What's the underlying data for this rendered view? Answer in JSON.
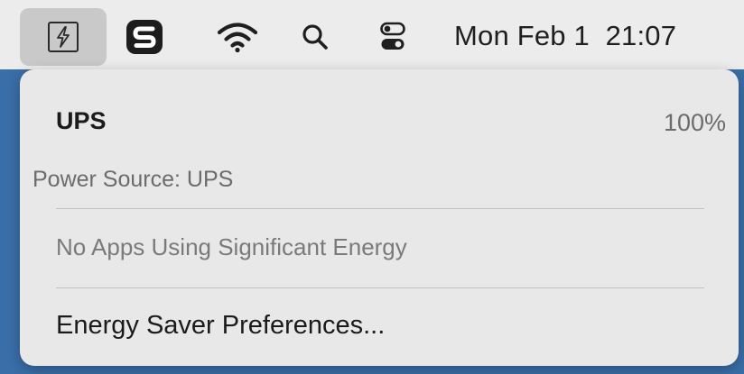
{
  "menubar": {
    "icons": [
      "power-icon",
      "s-app-icon",
      "wifi-icon",
      "search-icon",
      "control-center-icon"
    ],
    "clock": "Mon Feb 1  21:07"
  },
  "power_menu": {
    "title": "UPS",
    "percent": "100%",
    "power_source": "Power Source: UPS",
    "energy_status": "No Apps Using Significant Energy",
    "preferences_label": "Energy Saver Preferences..."
  },
  "colors": {
    "menubar_bg": "#ececec",
    "dropdown_bg": "#e8e8e8",
    "desktop_bg": "#3a6ea8",
    "selected_item_bg": "#c9c9c9"
  }
}
